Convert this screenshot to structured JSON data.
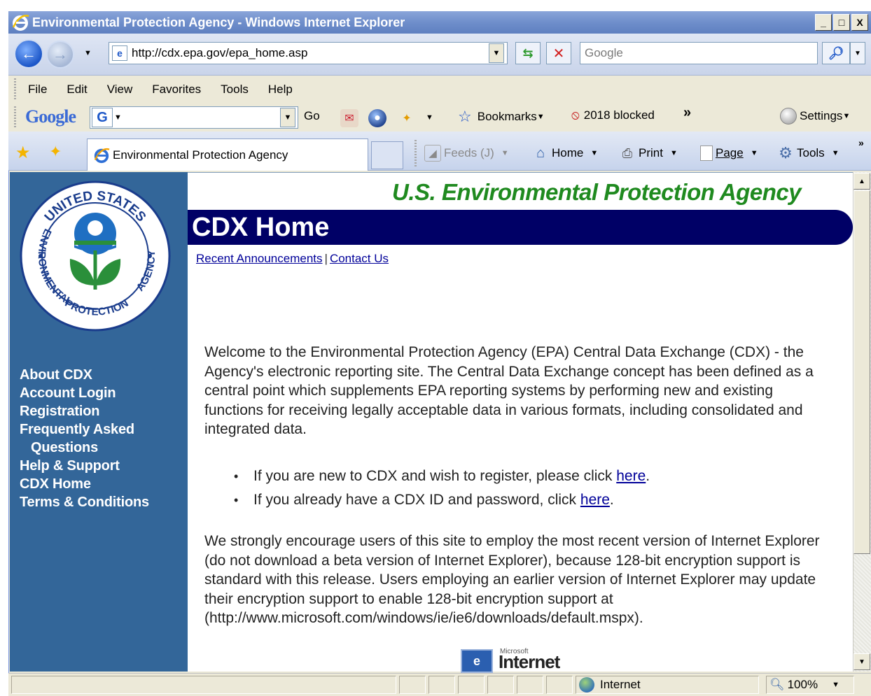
{
  "window": {
    "title": "Environmental Protection Agency - Windows Internet Explorer",
    "buttons": {
      "minimize": "_",
      "maximize": "□",
      "close": "X"
    }
  },
  "address_bar": {
    "url": "http://cdx.epa.gov/epa_home.asp",
    "search_placeholder": "Google"
  },
  "menu": [
    "File",
    "Edit",
    "View",
    "Favorites",
    "Tools",
    "Help"
  ],
  "google_toolbar": {
    "logo": "Google",
    "go_label": "Go",
    "bookmarks_label": "Bookmarks",
    "blocked_label": "2018 blocked",
    "settings_label": "Settings"
  },
  "tabs": [
    {
      "label": "Environmental Protection Agency"
    }
  ],
  "command_bar": {
    "feeds": "Feeds (J)",
    "home": "Home",
    "print": "Print",
    "page": "Page",
    "tools": "Tools"
  },
  "page": {
    "agency_name": "U.S. Environmental Protection Agency",
    "banner_title": "CDX Home",
    "top_links": [
      "Recent Announcements",
      "Contact Us"
    ],
    "link_separator": "|",
    "sidebar": {
      "seal_text_top": "UNITED STATES",
      "seal_text_left": "ENVIRONMENTAL",
      "seal_text_right": "AGENCY",
      "seal_text_bottom": "PROTECTION",
      "nav": [
        "About CDX",
        "Account Login",
        "Registration",
        "Frequently Asked",
        "Questions",
        "Help & Support",
        "CDX Home",
        "Terms & Conditions"
      ]
    },
    "welcome_text": "Welcome to the Environmental Protection Agency (EPA) Central Data Exchange (CDX) - the Agency's electronic reporting site. The Central Data Exchange concept has been defined as a central point which supplements EPA reporting systems by performing new and existing functions for receiving legally acceptable data in various formats, including consolidated and integrated data.",
    "bullets": [
      {
        "text": "If you are new to CDX and wish to register, please click ",
        "link": "here",
        "end": "."
      },
      {
        "text": "If you already have a CDX ID and password, click ",
        "link": "here",
        "end": "."
      }
    ],
    "encourage_text": "We strongly encourage users of this site to employ the most recent version of Internet Explorer (do not download a beta version of Internet Explorer), because 128-bit encryption support is standard with this release. Users employing an earlier version of Internet Explorer may update their encryption support to enable 128-bit encryption support at (http://www.microsoft.com/windows/ie/ie6/downloads/default.mspx).",
    "ie_logo": {
      "small": "Microsoft",
      "word": "Internet"
    }
  },
  "status_bar": {
    "zone": "Internet",
    "zoom": "100%"
  },
  "colors": {
    "sidebar": "#336699",
    "banner": "#000066",
    "agency_name": "#1f8a1f",
    "link": "#000099"
  }
}
